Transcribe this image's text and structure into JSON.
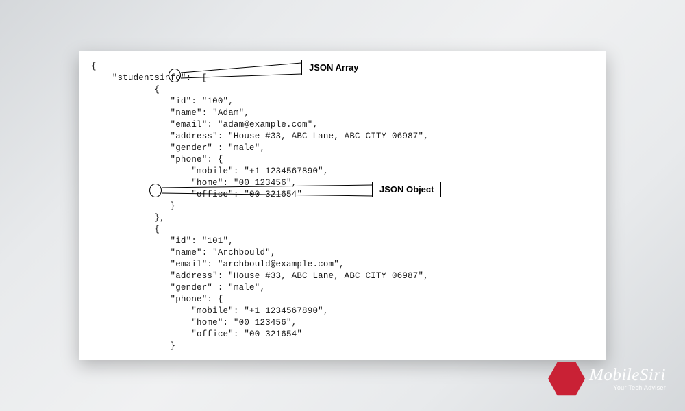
{
  "annotation_array": "JSON Array",
  "annotation_object": "JSON Object",
  "logo": {
    "main": "MobileSiri",
    "sub": "Your Tech Adviser"
  },
  "code": {
    "l1": "{",
    "l2": "    \"studentsinfo\":  [",
    "l3": "            {",
    "l4": "               \"id\": \"100\",",
    "l5": "               \"name\": \"Adam\",",
    "l6": "               \"email\": \"adam@example.com\",",
    "l7": "               \"address\": \"House #33, ABC Lane, ABC CITY 06987\",",
    "l8": "               \"gender\" : \"male\",",
    "l9": "               \"phone\": {",
    "l10": "                   \"mobile\": \"+1 1234567890\",",
    "l11": "                   \"home\": \"00 123456\",",
    "l12": "                   \"office\": \"00 321654\"",
    "l13": "               }",
    "l14": "            },",
    "l15": "            {",
    "l16": "               \"id\": \"101\",",
    "l17": "               \"name\": \"Archbould\",",
    "l18": "               \"email\": \"archbould@example.com\",",
    "l19": "               \"address\": \"House #33, ABC Lane, ABC CITY 06987\",",
    "l20": "               \"gender\" : \"male\",",
    "l21": "               \"phone\": {",
    "l22": "                   \"mobile\": \"+1 1234567890\",",
    "l23": "                   \"home\": \"00 123456\",",
    "l24": "                   \"office\": \"00 321654\"",
    "l25": "               }"
  }
}
